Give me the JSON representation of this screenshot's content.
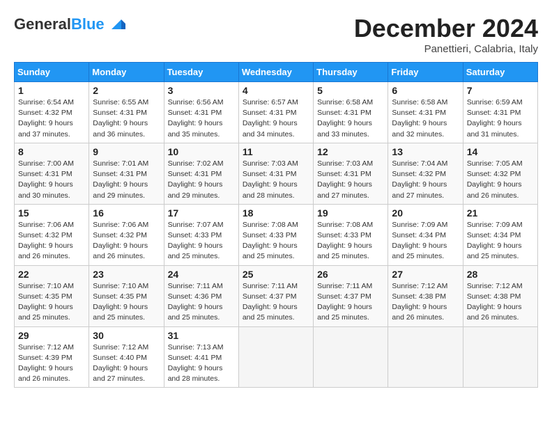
{
  "header": {
    "logo_general": "General",
    "logo_blue": "Blue",
    "month": "December 2024",
    "location": "Panettieri, Calabria, Italy"
  },
  "days_of_week": [
    "Sunday",
    "Monday",
    "Tuesday",
    "Wednesday",
    "Thursday",
    "Friday",
    "Saturday"
  ],
  "weeks": [
    [
      {
        "day": "1",
        "info": "Sunrise: 6:54 AM\nSunset: 4:32 PM\nDaylight: 9 hours\nand 37 minutes."
      },
      {
        "day": "2",
        "info": "Sunrise: 6:55 AM\nSunset: 4:31 PM\nDaylight: 9 hours\nand 36 minutes."
      },
      {
        "day": "3",
        "info": "Sunrise: 6:56 AM\nSunset: 4:31 PM\nDaylight: 9 hours\nand 35 minutes."
      },
      {
        "day": "4",
        "info": "Sunrise: 6:57 AM\nSunset: 4:31 PM\nDaylight: 9 hours\nand 34 minutes."
      },
      {
        "day": "5",
        "info": "Sunrise: 6:58 AM\nSunset: 4:31 PM\nDaylight: 9 hours\nand 33 minutes."
      },
      {
        "day": "6",
        "info": "Sunrise: 6:58 AM\nSunset: 4:31 PM\nDaylight: 9 hours\nand 32 minutes."
      },
      {
        "day": "7",
        "info": "Sunrise: 6:59 AM\nSunset: 4:31 PM\nDaylight: 9 hours\nand 31 minutes."
      }
    ],
    [
      {
        "day": "8",
        "info": "Sunrise: 7:00 AM\nSunset: 4:31 PM\nDaylight: 9 hours\nand 30 minutes."
      },
      {
        "day": "9",
        "info": "Sunrise: 7:01 AM\nSunset: 4:31 PM\nDaylight: 9 hours\nand 29 minutes."
      },
      {
        "day": "10",
        "info": "Sunrise: 7:02 AM\nSunset: 4:31 PM\nDaylight: 9 hours\nand 29 minutes."
      },
      {
        "day": "11",
        "info": "Sunrise: 7:03 AM\nSunset: 4:31 PM\nDaylight: 9 hours\nand 28 minutes."
      },
      {
        "day": "12",
        "info": "Sunrise: 7:03 AM\nSunset: 4:31 PM\nDaylight: 9 hours\nand 27 minutes."
      },
      {
        "day": "13",
        "info": "Sunrise: 7:04 AM\nSunset: 4:32 PM\nDaylight: 9 hours\nand 27 minutes."
      },
      {
        "day": "14",
        "info": "Sunrise: 7:05 AM\nSunset: 4:32 PM\nDaylight: 9 hours\nand 26 minutes."
      }
    ],
    [
      {
        "day": "15",
        "info": "Sunrise: 7:06 AM\nSunset: 4:32 PM\nDaylight: 9 hours\nand 26 minutes."
      },
      {
        "day": "16",
        "info": "Sunrise: 7:06 AM\nSunset: 4:32 PM\nDaylight: 9 hours\nand 26 minutes."
      },
      {
        "day": "17",
        "info": "Sunrise: 7:07 AM\nSunset: 4:33 PM\nDaylight: 9 hours\nand 25 minutes."
      },
      {
        "day": "18",
        "info": "Sunrise: 7:08 AM\nSunset: 4:33 PM\nDaylight: 9 hours\nand 25 minutes."
      },
      {
        "day": "19",
        "info": "Sunrise: 7:08 AM\nSunset: 4:33 PM\nDaylight: 9 hours\nand 25 minutes."
      },
      {
        "day": "20",
        "info": "Sunrise: 7:09 AM\nSunset: 4:34 PM\nDaylight: 9 hours\nand 25 minutes."
      },
      {
        "day": "21",
        "info": "Sunrise: 7:09 AM\nSunset: 4:34 PM\nDaylight: 9 hours\nand 25 minutes."
      }
    ],
    [
      {
        "day": "22",
        "info": "Sunrise: 7:10 AM\nSunset: 4:35 PM\nDaylight: 9 hours\nand 25 minutes."
      },
      {
        "day": "23",
        "info": "Sunrise: 7:10 AM\nSunset: 4:35 PM\nDaylight: 9 hours\nand 25 minutes."
      },
      {
        "day": "24",
        "info": "Sunrise: 7:11 AM\nSunset: 4:36 PM\nDaylight: 9 hours\nand 25 minutes."
      },
      {
        "day": "25",
        "info": "Sunrise: 7:11 AM\nSunset: 4:37 PM\nDaylight: 9 hours\nand 25 minutes."
      },
      {
        "day": "26",
        "info": "Sunrise: 7:11 AM\nSunset: 4:37 PM\nDaylight: 9 hours\nand 25 minutes."
      },
      {
        "day": "27",
        "info": "Sunrise: 7:12 AM\nSunset: 4:38 PM\nDaylight: 9 hours\nand 26 minutes."
      },
      {
        "day": "28",
        "info": "Sunrise: 7:12 AM\nSunset: 4:38 PM\nDaylight: 9 hours\nand 26 minutes."
      }
    ],
    [
      {
        "day": "29",
        "info": "Sunrise: 7:12 AM\nSunset: 4:39 PM\nDaylight: 9 hours\nand 26 minutes."
      },
      {
        "day": "30",
        "info": "Sunrise: 7:12 AM\nSunset: 4:40 PM\nDaylight: 9 hours\nand 27 minutes."
      },
      {
        "day": "31",
        "info": "Sunrise: 7:13 AM\nSunset: 4:41 PM\nDaylight: 9 hours\nand 28 minutes."
      },
      {
        "day": "",
        "info": ""
      },
      {
        "day": "",
        "info": ""
      },
      {
        "day": "",
        "info": ""
      },
      {
        "day": "",
        "info": ""
      }
    ]
  ]
}
